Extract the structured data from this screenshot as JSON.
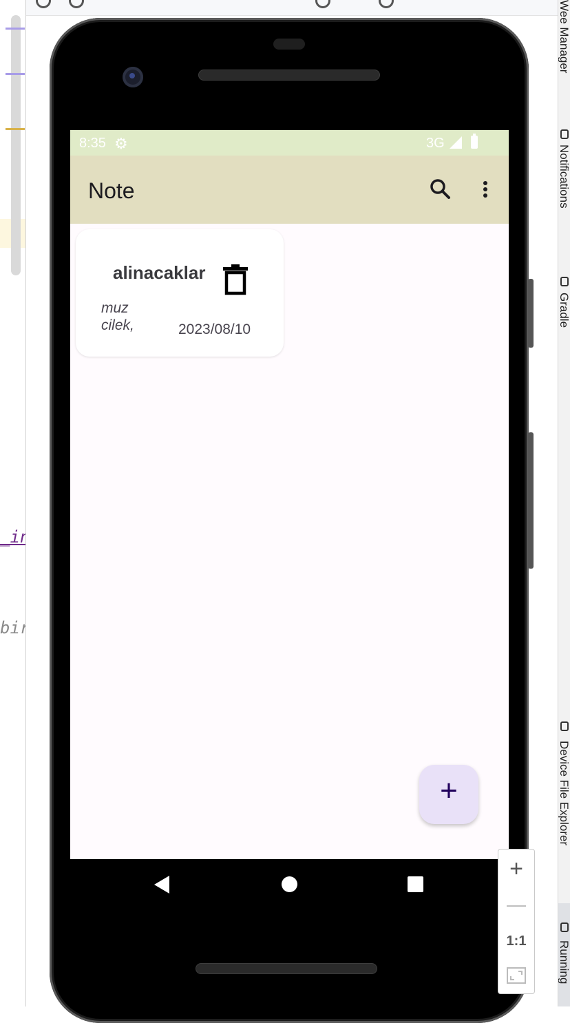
{
  "ide": {
    "code_fragments": [
      "_in",
      "bir"
    ],
    "right_rail": [
      "Wee Manager",
      "Notifications",
      "Gradle",
      "Device File Explorer",
      "Running"
    ]
  },
  "status_bar": {
    "time": "8:35",
    "network": "3G",
    "icons": [
      "settings-gear-icon",
      "signal-icon",
      "battery-icon"
    ],
    "background": "#e0ebc8"
  },
  "app_bar": {
    "title": "Note",
    "actions": [
      "search-icon",
      "overflow-menu-icon"
    ],
    "background": "#e2dec0"
  },
  "notes": [
    {
      "title": "alinacaklar",
      "body_lines": [
        "muz",
        "cilek,"
      ],
      "date": "2023/08/10"
    }
  ],
  "fab": {
    "label": "+",
    "icon": "add-icon",
    "background": "#e9e1f8"
  },
  "nav_bar": {
    "buttons": [
      "back-icon",
      "home-icon",
      "recents-icon"
    ]
  },
  "zoom_controls": {
    "zoom_in": "+",
    "zoom_out": "—",
    "actual_size": "1:1",
    "fit": "fit-screen-icon"
  }
}
